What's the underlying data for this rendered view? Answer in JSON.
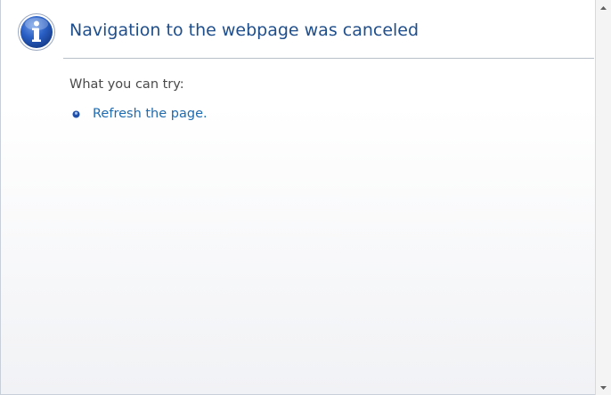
{
  "error": {
    "title": "Navigation to the webpage was canceled",
    "subheading": "What you can try:",
    "options": [
      {
        "label": "Refresh the page."
      }
    ],
    "icon": "info-icon"
  },
  "colors": {
    "title": "#1f4e8c",
    "link": "#1e6bb0",
    "text": "#4a4a4a",
    "icon_blue": "#1f4fa8"
  },
  "scrollbar": {
    "up_icon": "scroll-up-arrow-icon",
    "down_icon": "scroll-down-arrow-icon"
  }
}
